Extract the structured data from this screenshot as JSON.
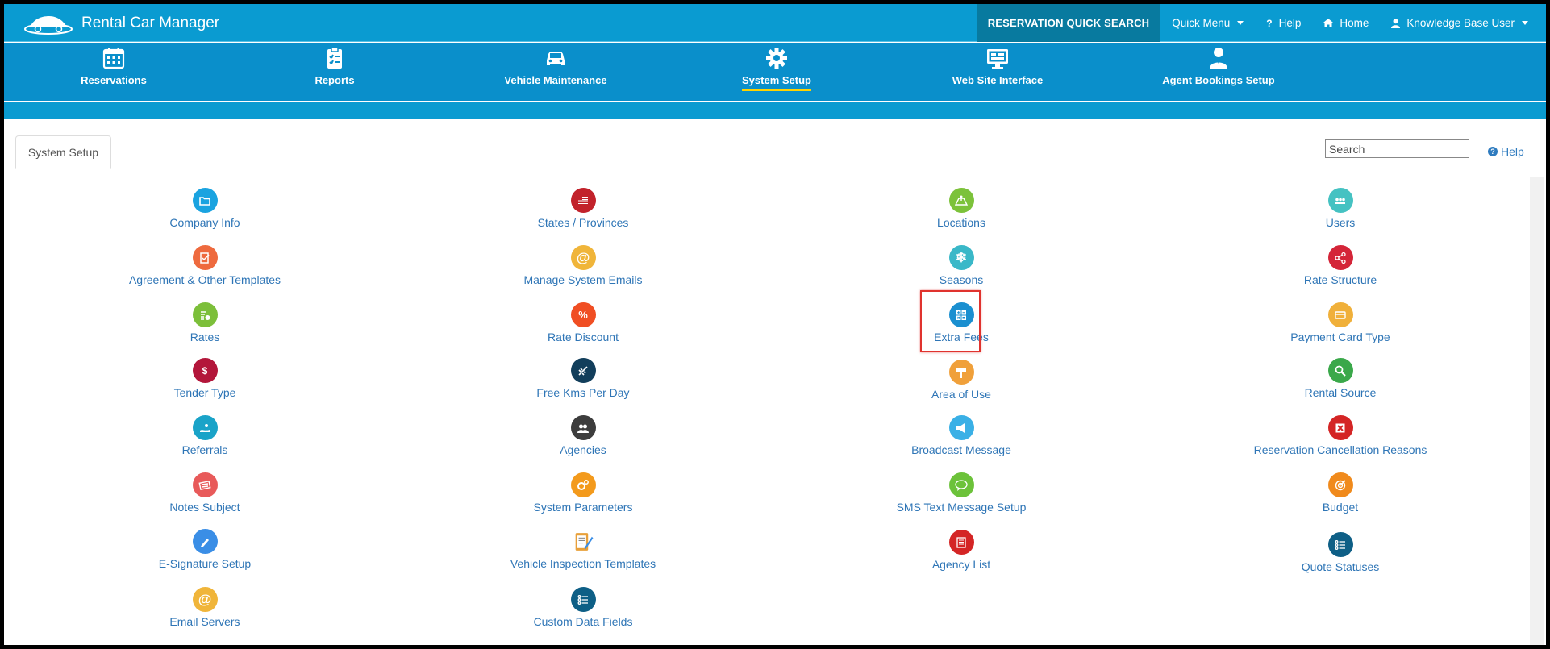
{
  "app": {
    "title": "Rental Car Manager",
    "accent": "#0a9bd1",
    "nav_bg": "#0a8fcb",
    "active_underline": "#ffd200"
  },
  "topbar": {
    "quick_search": "RESERVATION QUICK SEARCH",
    "quick_menu": "Quick Menu",
    "help": "Help",
    "home": "Home",
    "user": "Knowledge Base User"
  },
  "nav": [
    {
      "label": "Reservations",
      "icon": "calendar-icon"
    },
    {
      "label": "Reports",
      "icon": "clipboard-icon"
    },
    {
      "label": "Vehicle Maintenance",
      "icon": "car-icon"
    },
    {
      "label": "System Setup",
      "icon": "gear-icon",
      "active": true
    },
    {
      "label": "Web Site Interface",
      "icon": "monitor-icon"
    },
    {
      "label": "Agent Bookings Setup",
      "icon": "agent-icon"
    }
  ],
  "tab": {
    "label": "System Setup"
  },
  "search": {
    "placeholder": "Search"
  },
  "help_link": "Help",
  "columns": [
    [
      {
        "label": "Company Info",
        "icon": "folder-icon",
        "color": "#1aa3e0"
      },
      {
        "label": "Agreement & Other Templates",
        "icon": "document-edit-icon",
        "color": "#ee6a3e"
      },
      {
        "label": "Rates",
        "icon": "rates-icon",
        "color": "#7cbf3a"
      },
      {
        "label": "Tender Type",
        "icon": "money-bag-icon",
        "color": "#b3163a"
      },
      {
        "label": "Referrals",
        "icon": "hand-icon",
        "color": "#1aa3c8"
      },
      {
        "label": "Notes Subject",
        "icon": "notes-icon",
        "color": "#e85a5a"
      },
      {
        "label": "E-Signature Setup",
        "icon": "pen-icon",
        "color": "#3a8ee6"
      },
      {
        "label": "Email Servers",
        "icon": "at-icon",
        "color": "#f0b53a"
      }
    ],
    [
      {
        "label": "States / Provinces",
        "icon": "flag-icon",
        "color": "#c2222b"
      },
      {
        "label": "Manage System Emails",
        "icon": "at-icon",
        "color": "#f0b53a"
      },
      {
        "label": "Rate Discount",
        "icon": "percent-icon",
        "color": "#f04e23"
      },
      {
        "label": "Free Kms Per Day",
        "icon": "road-icon",
        "color": "#123e5b"
      },
      {
        "label": "Agencies",
        "icon": "people-icon",
        "color": "#3d3d3d"
      },
      {
        "label": "System Parameters",
        "icon": "gears-icon",
        "color": "#f39a1c"
      },
      {
        "label": "Vehicle Inspection Templates",
        "icon": "clipboard-pencil-icon",
        "color": "#e8a03a"
      },
      {
        "label": "Custom Data Fields",
        "icon": "list-icon",
        "color": "#0e5f86"
      }
    ],
    [
      {
        "label": "Locations",
        "icon": "map-icon",
        "color": "#7cc23a"
      },
      {
        "label": "Seasons",
        "icon": "snowflake-icon",
        "color": "#3ab8c8"
      },
      {
        "label": "Extra Fees",
        "icon": "calculator-icon",
        "color": "#1a8fd0",
        "highlighted": true
      },
      {
        "label": "Area of Use",
        "icon": "signpost-icon",
        "color": "#f0a03a"
      },
      {
        "label": "Broadcast Message",
        "icon": "megaphone-icon",
        "color": "#3ab0e6"
      },
      {
        "label": "SMS Text Message Setup",
        "icon": "sms-icon",
        "color": "#6cc23a"
      },
      {
        "label": "Agency List",
        "icon": "list-doc-icon",
        "color": "#d42525"
      }
    ],
    [
      {
        "label": "Users",
        "icon": "users-icon",
        "color": "#45c2c2"
      },
      {
        "label": "Rate Structure",
        "icon": "share-icon",
        "color": "#d42538"
      },
      {
        "label": "Payment Card Type",
        "icon": "card-icon",
        "color": "#f0b03a"
      },
      {
        "label": "Rental Source",
        "icon": "magnifier-icon",
        "color": "#3aa84a"
      },
      {
        "label": "Reservation Cancellation Reasons",
        "icon": "cancel-icon",
        "color": "#d42525"
      },
      {
        "label": "Budget",
        "icon": "target-icon",
        "color": "#f08a1c"
      },
      {
        "label": "Quote Statuses",
        "icon": "list-icon",
        "color": "#0e5f86"
      }
    ]
  ]
}
